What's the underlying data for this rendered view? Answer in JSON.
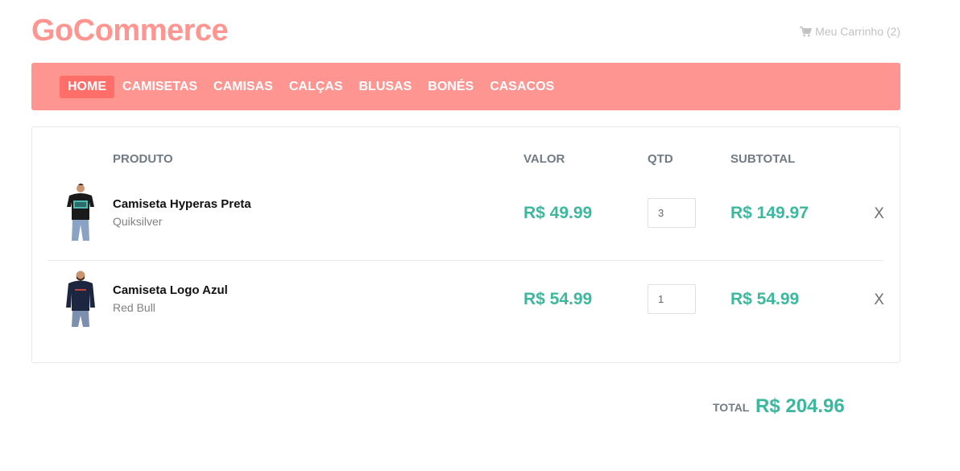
{
  "brand": {
    "name": "GoCommerce",
    "color": "#ff9591"
  },
  "header": {
    "cart_label": "Meu Carrinho (2)",
    "cart_icon": "shopping-cart-icon"
  },
  "nav": {
    "items": [
      {
        "label": "HOME",
        "active": true
      },
      {
        "label": "CAMISETAS",
        "active": false
      },
      {
        "label": "CAMISAS",
        "active": false
      },
      {
        "label": "CALÇAS",
        "active": false
      },
      {
        "label": "BLUSAS",
        "active": false
      },
      {
        "label": "BONÉS",
        "active": false
      },
      {
        "label": "CASACOS",
        "active": false
      }
    ]
  },
  "table": {
    "headers": {
      "product": "PRODUTO",
      "price": "VALOR",
      "qty": "QTD",
      "subtotal": "SUBTOTAL"
    },
    "rows": [
      {
        "name": "Camiseta Hyperas Preta",
        "brand": "Quiksilver",
        "price": "R$ 49.99",
        "qty": "3",
        "subtotal": "R$ 149.97",
        "remove": "X",
        "image": "black-tshirt-model"
      },
      {
        "name": "Camiseta Logo Azul",
        "brand": "Red Bull",
        "price": "R$ 54.99",
        "qty": "1",
        "subtotal": "R$ 54.99",
        "remove": "X",
        "image": "navy-hoodie-model"
      }
    ]
  },
  "total": {
    "label": "TOTAL",
    "value": "R$ 204.96"
  },
  "colors": {
    "accent": "#ff9591",
    "active_nav": "#ff6e69",
    "price": "#3bb89e",
    "header_text": "#727a83"
  }
}
